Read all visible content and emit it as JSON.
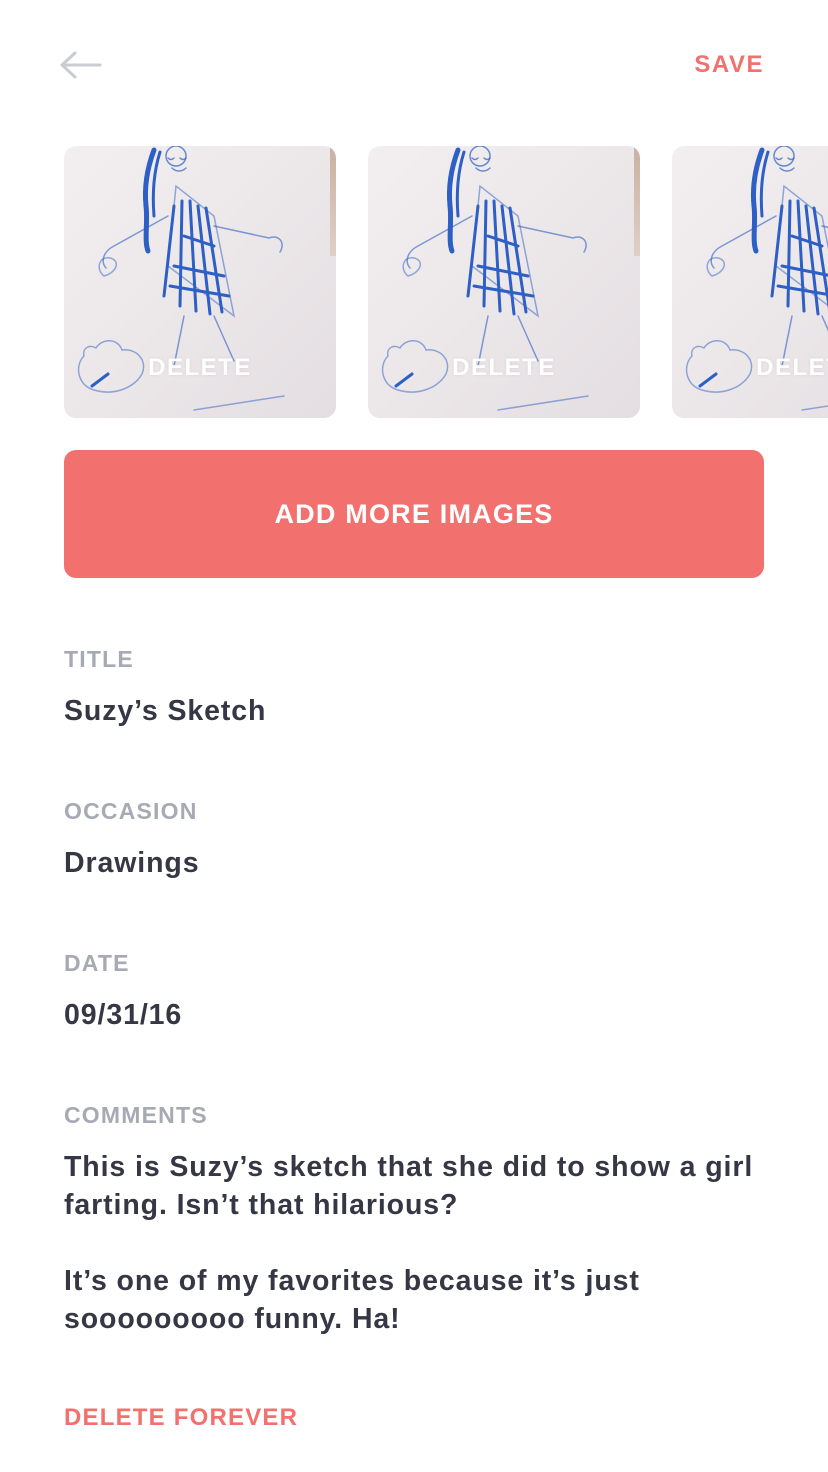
{
  "header": {
    "back_icon": "arrow-left-icon",
    "save_label": "SAVE"
  },
  "images": [
    {
      "delete_label": "DELETE"
    },
    {
      "delete_label": "DELETE"
    },
    {
      "delete_label": "DELETE"
    }
  ],
  "add_images_label": "ADD MORE IMAGES",
  "fields": {
    "title": {
      "label": "TITLE",
      "value": "Suzy’s Sketch"
    },
    "occasion": {
      "label": "OCCASION",
      "value": "Drawings"
    },
    "date": {
      "label": "DATE",
      "value": "09/31/16"
    },
    "comments": {
      "label": "COMMENTS",
      "paragraph1": "This is Suzy’s sketch that she did to show a girl farting. Isn’t that hilarious?",
      "paragraph2": "It’s one of my favorites because it’s just sooooooooo funny. Ha!"
    }
  },
  "delete_forever_label": "DELETE FOREVER",
  "colors": {
    "accent": "#f2706e",
    "label": "#a5aab3",
    "text": "#353844",
    "sketch_ink": "#2d5fc4"
  }
}
